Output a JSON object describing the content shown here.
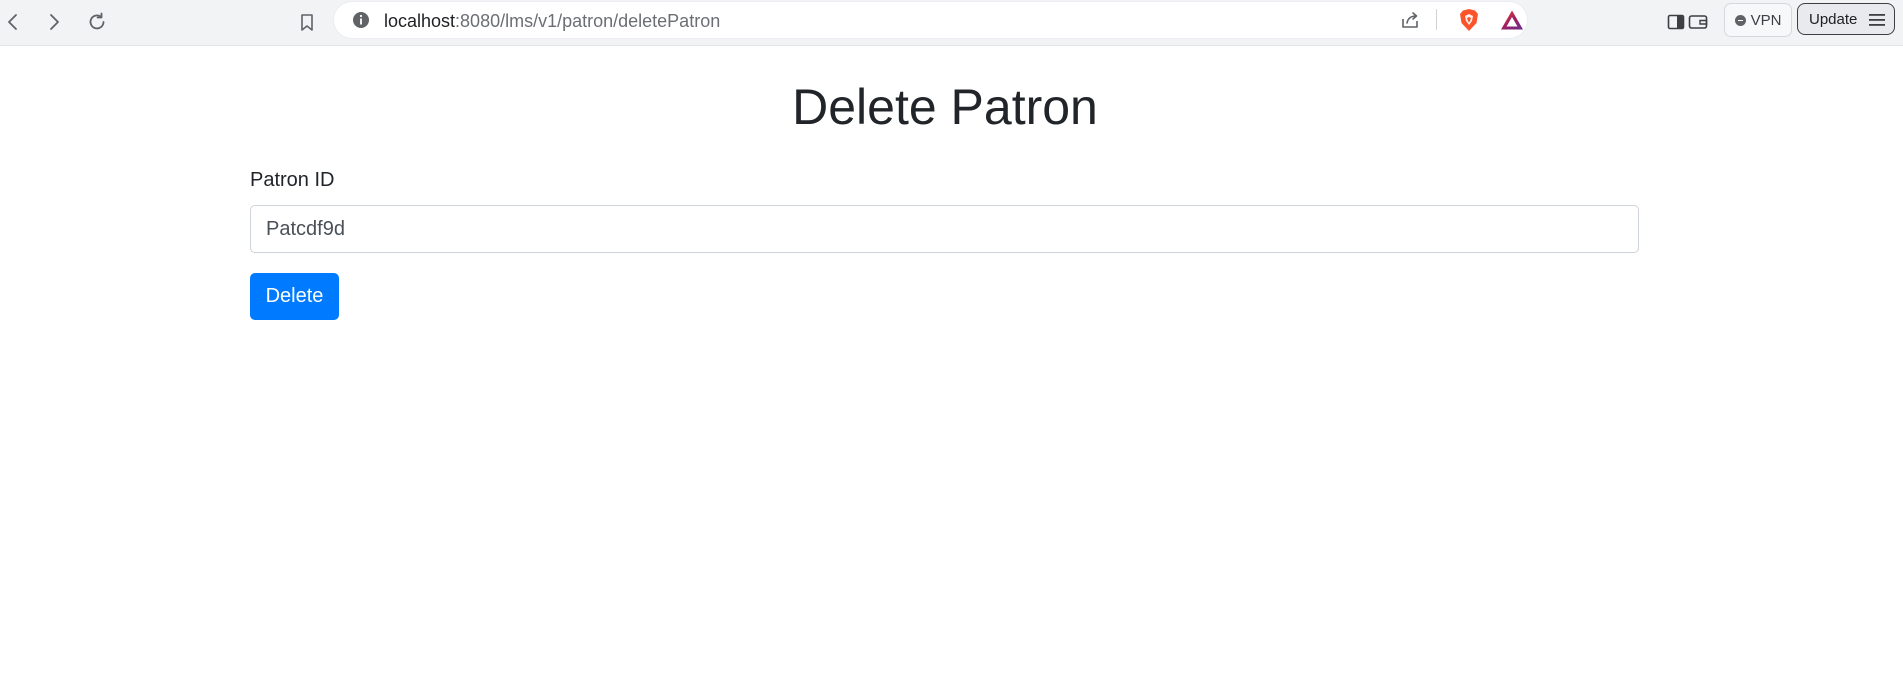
{
  "browser": {
    "url_host": "localhost",
    "url_path": ":8080/lms/v1/patron/deletePatron",
    "vpn_label": "VPN",
    "update_label": "Update",
    "colors": {
      "toolbar_bg": "#f1f3f4",
      "brave_orange": "#fb542b"
    }
  },
  "page": {
    "title": "Delete Patron",
    "patron_id_label": "Patron ID",
    "patron_id_value": "Patcdf9d",
    "delete_label": "Delete",
    "colors": {
      "primary": "#007bff",
      "text": "#212529"
    }
  },
  "icons": [
    "back-icon",
    "forward-icon",
    "reload-icon",
    "bookmark-icon",
    "site-info-icon",
    "share-icon",
    "brave-shields-icon",
    "brave-rewards-icon",
    "sidebar-icon",
    "wallet-icon",
    "menu-icon"
  ]
}
